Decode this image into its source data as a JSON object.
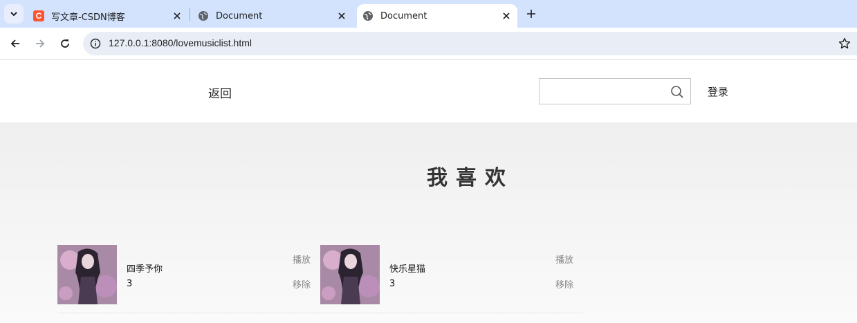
{
  "browser": {
    "tabs": [
      {
        "title": "写文章-CSDN博客",
        "favicon": "C",
        "active": false
      },
      {
        "title": "Document",
        "active": false
      },
      {
        "title": "Document",
        "active": true
      }
    ],
    "url": "127.0.0.1:8080/lovemusiclist.html"
  },
  "header": {
    "back_label": "返回",
    "search_placeholder": "",
    "login_label": "登录"
  },
  "main": {
    "title": "我喜欢",
    "songs": [
      {
        "name": "四季予你",
        "singer": "3",
        "play_label": "播放",
        "remove_label": "移除"
      },
      {
        "name": "快乐星猫",
        "singer": "3",
        "play_label": "播放",
        "remove_label": "移除"
      }
    ]
  },
  "colors": {
    "tabstrip": "#d3e3fd",
    "omnibox": "#e9eef6",
    "csdn_brand": "#fc5531",
    "action_text": "#888888"
  }
}
